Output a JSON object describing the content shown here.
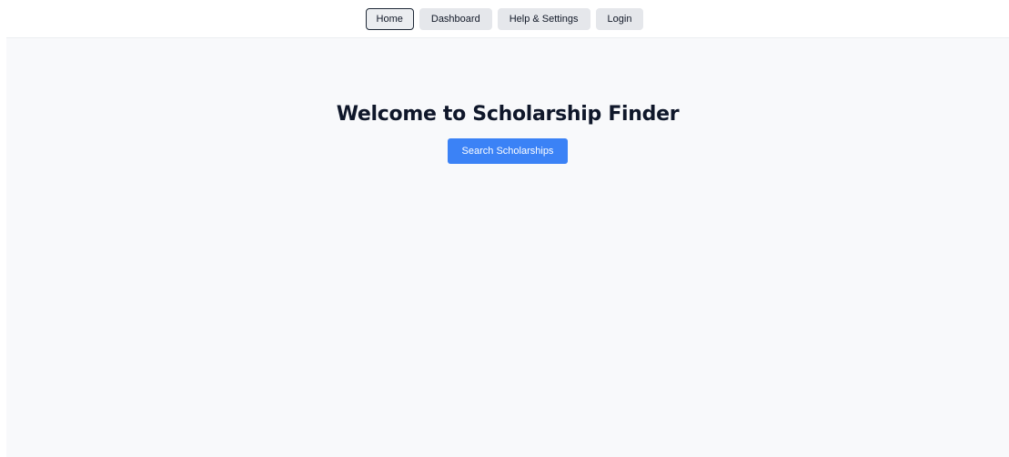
{
  "nav": {
    "items": [
      {
        "label": "Home",
        "active": true
      },
      {
        "label": "Dashboard",
        "active": false
      },
      {
        "label": "Help & Settings",
        "active": false
      },
      {
        "label": "Login",
        "active": false
      }
    ]
  },
  "hero": {
    "title": "Welcome to Scholarship Finder",
    "cta_label": "Search Scholarships"
  },
  "colors": {
    "accent": "#3b82f6",
    "page_background": "#f8f9fb",
    "nav_button": "#e5e7eb",
    "title_text": "#0f172a"
  }
}
